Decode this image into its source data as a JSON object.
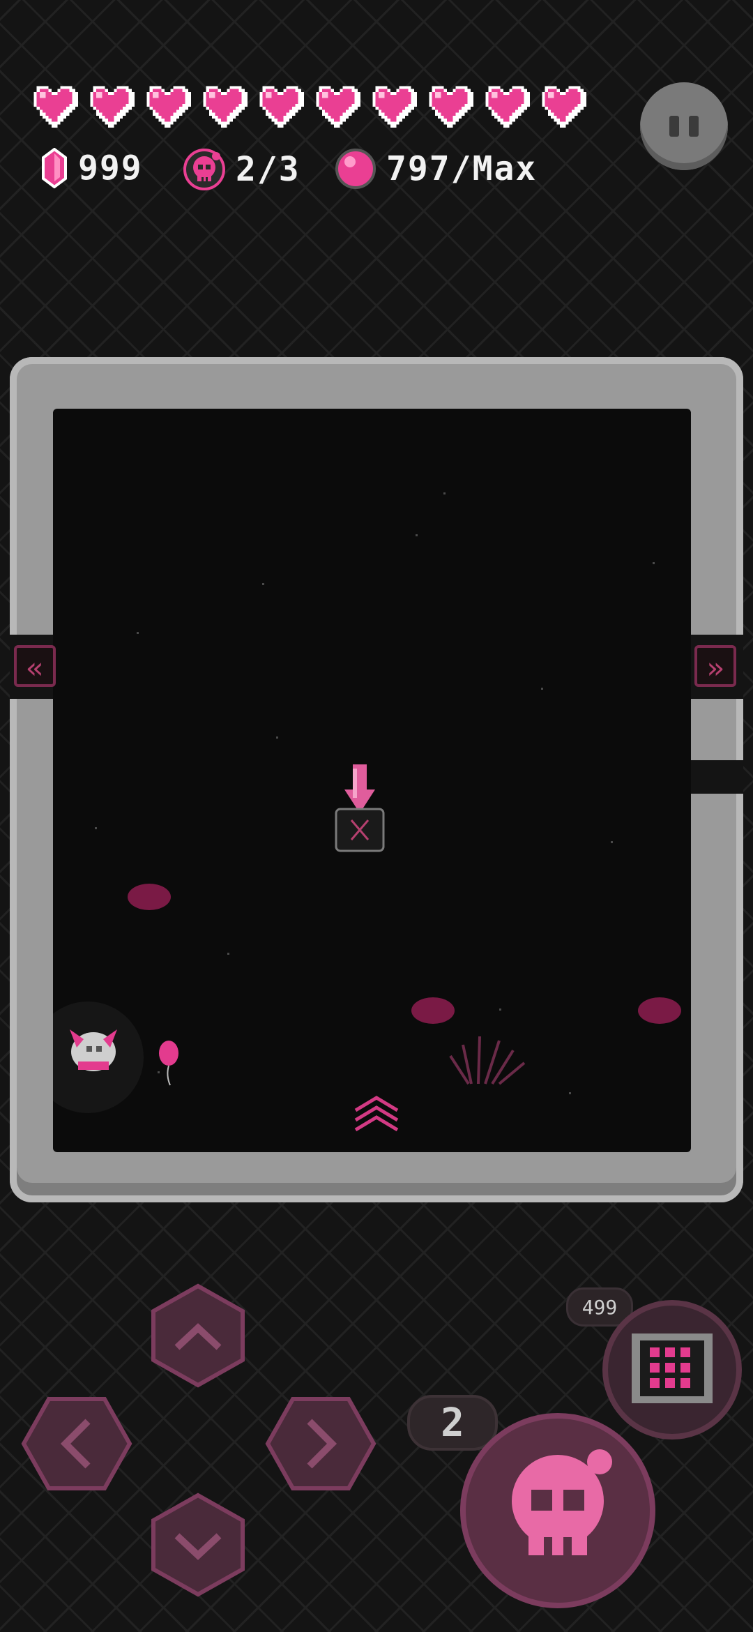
{
  "hud": {
    "hearts_full": 10,
    "gems": "999",
    "kills": "2/3",
    "orbs": "797/Max",
    "icons": {
      "heart": "heart-icon",
      "gem": "crystal-icon",
      "skull_badge": "skull-badge-icon",
      "orb": "orb-icon",
      "pause": "pause-icon"
    }
  },
  "controls": {
    "special_cost": "499",
    "ammo_count": "2",
    "dpad": [
      "up",
      "left",
      "right",
      "down"
    ]
  },
  "colors": {
    "accent_pink": "#e33b8e",
    "heart_pink": "#ea3f93",
    "button_fill": "#5a2f44",
    "button_border": "#7c3c5e",
    "wall_gray": "#9a9a9a",
    "floor": "#0b0b0b"
  }
}
